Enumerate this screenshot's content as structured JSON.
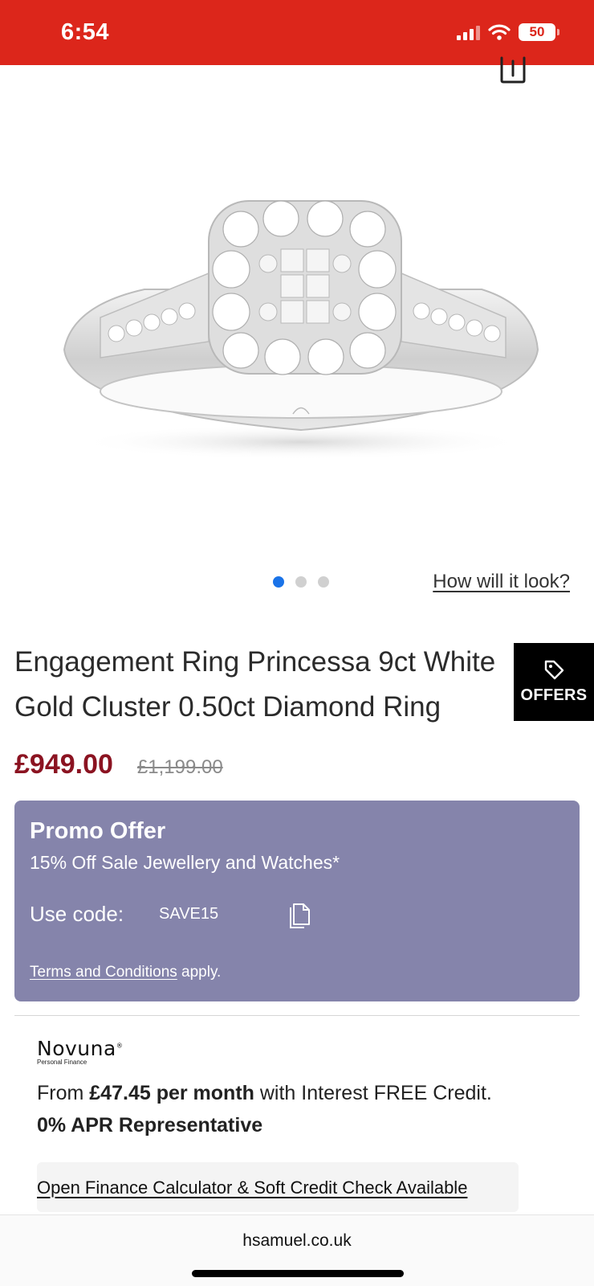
{
  "status_bar": {
    "time": "6:54",
    "battery": "50",
    "background_color": "#dc261b"
  },
  "gallery": {
    "image_alt": "Engagement ring with diamond cluster",
    "dots_total": 3,
    "active_dot": 1,
    "try_on_link": "How will it look?"
  },
  "product": {
    "title_line1": "Engagement Ring Princessa 9ct White",
    "title_line2": "Gold Cluster 0.50ct Diamond Ring",
    "offers_label": "OFFERS",
    "price_now": "£949.00",
    "price_was": "£1,199.00",
    "price_color": "#8b1321"
  },
  "promo": {
    "title": "Promo Offer",
    "description": "15% Off Sale Jewellery and Watches*",
    "code_label": "Use code:",
    "code": "SAVE15",
    "terms_link": "Terms and Conditions",
    "terms_suffix": " apply.",
    "background_color": "#8584ab"
  },
  "finance": {
    "provider": "Novuna",
    "provider_sub": "Personal Finance",
    "from_text": "From ",
    "amount_text": "£47.45 per month",
    "credit_text": " with Interest FREE Credit.",
    "apr_text": "0% APR Representative",
    "calculator_link": "Open Finance Calculator & Soft Credit Check Available"
  },
  "browser": {
    "url": "hsamuel.co.uk"
  }
}
